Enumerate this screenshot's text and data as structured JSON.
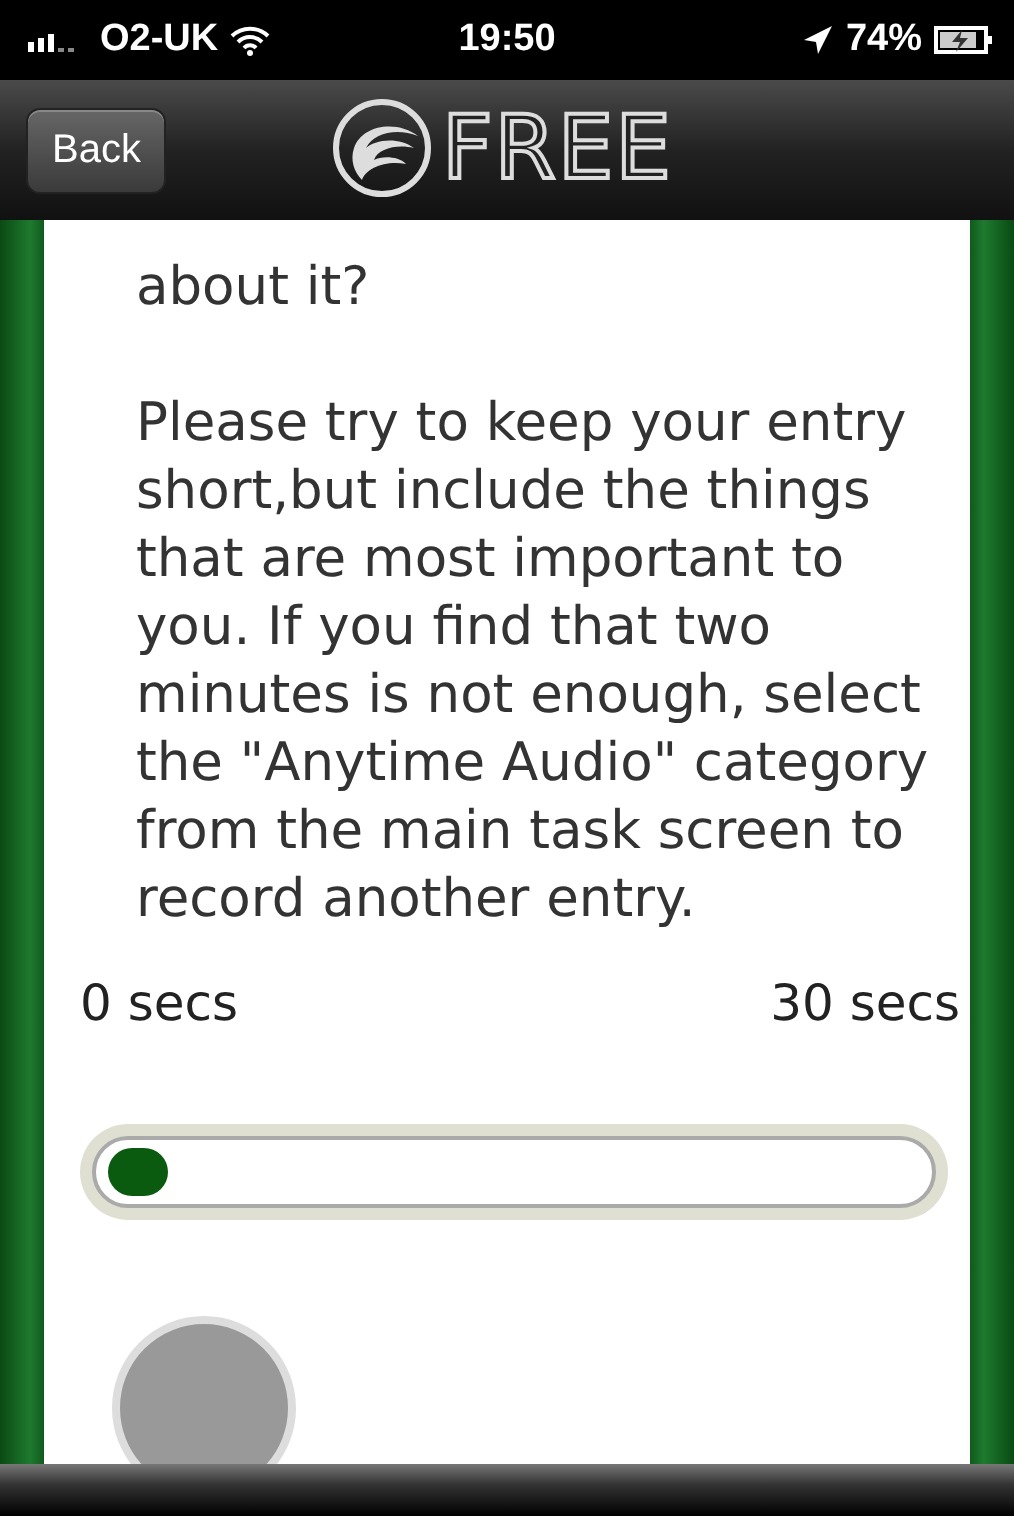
{
  "status_bar": {
    "carrier": "O2-UK",
    "time": "19:50",
    "battery": "74%"
  },
  "nav_bar": {
    "back": "Back",
    "logo_text": "FREE"
  },
  "content": {
    "question_tail": "about it?",
    "instructions": "Please try to keep your entry short,but include the things that are most important to you. If you find that two minutes is not enough, select the \"Anytime Audio\" category from the main task screen to record another entry."
  },
  "timer": {
    "start_label": "0 secs",
    "end_label": "30 secs",
    "level": 0.02
  }
}
